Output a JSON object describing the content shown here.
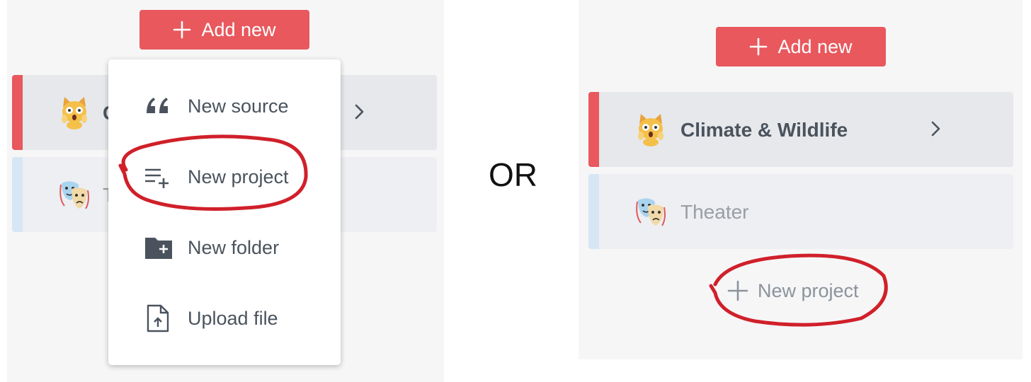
{
  "left": {
    "add_button_label": "Add new",
    "rows": [
      {
        "label": "C",
        "active": true
      },
      {
        "label": "T",
        "active": false
      }
    ],
    "menu": {
      "items": [
        {
          "label": "New source",
          "icon": "quote-icon"
        },
        {
          "label": "New project",
          "icon": "list-add-icon"
        },
        {
          "label": "New folder",
          "icon": "folder-add-icon"
        },
        {
          "label": "Upload file",
          "icon": "upload-file-icon"
        }
      ]
    }
  },
  "separator_label": "OR",
  "right": {
    "add_button_label": "Add new",
    "projects": [
      {
        "label": "Climate & Wildlife",
        "active": true
      },
      {
        "label": "Theater",
        "active": false
      }
    ],
    "new_project_label": "New project"
  },
  "colors": {
    "accent": "#e8585d",
    "active_bar": "#e8585d",
    "inactive_bar": "#d6e6f4",
    "annotation": "#d0202a"
  }
}
